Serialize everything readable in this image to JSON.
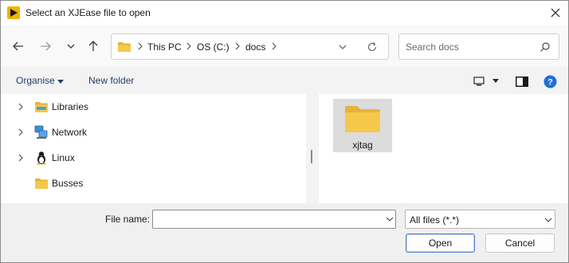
{
  "window": {
    "title": "Select an XJEase file to open"
  },
  "navigation": {
    "breadcrumbs": [
      "This PC",
      "OS (C:)",
      "docs"
    ],
    "search_placeholder": "Search docs"
  },
  "toolbar": {
    "organise_label": "Organise",
    "new_folder_label": "New folder"
  },
  "nav_pane": {
    "items": [
      {
        "label": "Libraries",
        "icon": "libraries-icon",
        "expandable": true
      },
      {
        "label": "Network",
        "icon": "network-icon",
        "expandable": true
      },
      {
        "label": "Linux",
        "icon": "linux-icon",
        "expandable": true
      },
      {
        "label": "Busses",
        "icon": "folder-icon",
        "expandable": false
      }
    ]
  },
  "content": {
    "items": [
      {
        "label": "xjtag",
        "icon": "folder-icon",
        "selected": true
      }
    ]
  },
  "bottom": {
    "file_name_label": "File name:",
    "file_name_value": "",
    "file_type_selected": "All files (*.*)",
    "open_label": "Open",
    "cancel_label": "Cancel"
  },
  "colors": {
    "folder_yellow": "#f6c84a",
    "link_blue": "#1f3f6a",
    "help_blue": "#1e6fd9",
    "selection_gray": "#dcdcdc"
  }
}
